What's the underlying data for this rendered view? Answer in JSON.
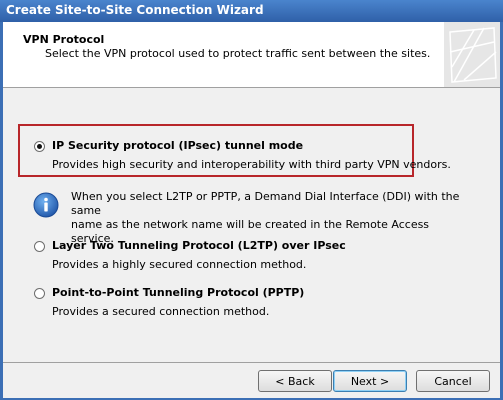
{
  "window": {
    "title": "Create Site-to-Site Connection Wizard"
  },
  "header": {
    "title": "VPN Protocol",
    "subtitle": "Select the VPN protocol used to protect traffic sent between the sites."
  },
  "options": [
    {
      "label": "IP Security protocol (IPsec) tunnel mode",
      "description": "Provides high security and interoperability with third party VPN vendors.",
      "selected": true
    },
    {
      "label": "Layer Two Tunneling Protocol (L2TP) over IPsec",
      "description": "Provides a highly secured connection method.",
      "selected": false
    },
    {
      "label": "Point-to-Point Tunneling Protocol (PPTP)",
      "description": "Provides a secured connection method.",
      "selected": false
    }
  ],
  "info": {
    "icon": "info-icon",
    "line1": "When you select L2TP or PPTP, a Demand Dial Interface (DDI) with the same",
    "line2": "name as the network name will be created in the Remote Access service."
  },
  "buttons": {
    "back": "< Back",
    "next": "Next >",
    "cancel": "Cancel"
  },
  "colors": {
    "titlebar": "#2f60a8",
    "highlight_border": "#b8262a",
    "info_icon": "#2f6fc0"
  }
}
